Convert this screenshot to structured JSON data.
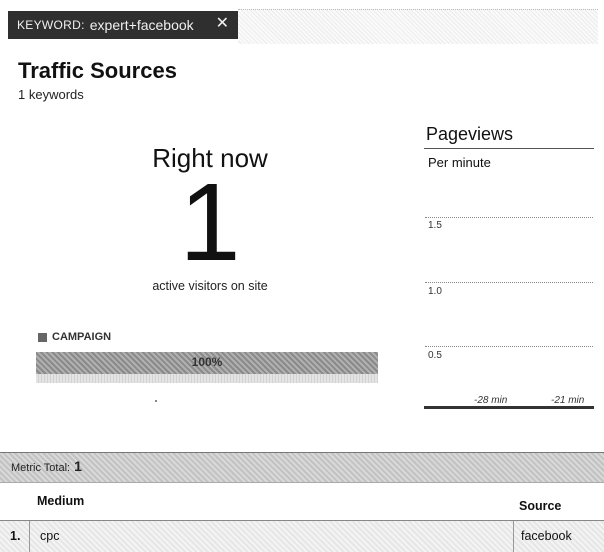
{
  "filter": {
    "keyword_label": "KEYWORD:",
    "keyword_value": "expert+facebook",
    "close_glyph": "✕"
  },
  "header": {
    "title": "Traffic Sources",
    "subtitle": "1 keywords"
  },
  "realtime": {
    "label": "Right now",
    "active_count": "1",
    "caption": "active visitors on site"
  },
  "campaign": {
    "label": "CAMPAIGN",
    "percent_text": "100%",
    "percent_value": 100
  },
  "pageviews": {
    "title": "Pageviews",
    "subtitle": "Per minute",
    "y_ticks": [
      "1.5",
      "1.0",
      "0.5"
    ],
    "x_ticks": [
      "-28 min",
      "-21 min"
    ]
  },
  "table": {
    "metric_total_label": "Metric Total:",
    "metric_total_value": "1",
    "columns": {
      "medium": "Medium",
      "source": "Source"
    },
    "rows": [
      {
        "index": "1.",
        "medium": "cpc",
        "source": "facebook"
      }
    ]
  },
  "colors": {
    "chip_bg": "#2f2f2f",
    "bar": "#9a9a9a"
  },
  "icons": {
    "close": "close-icon",
    "campaign_swatch": "legend-swatch-icon"
  }
}
